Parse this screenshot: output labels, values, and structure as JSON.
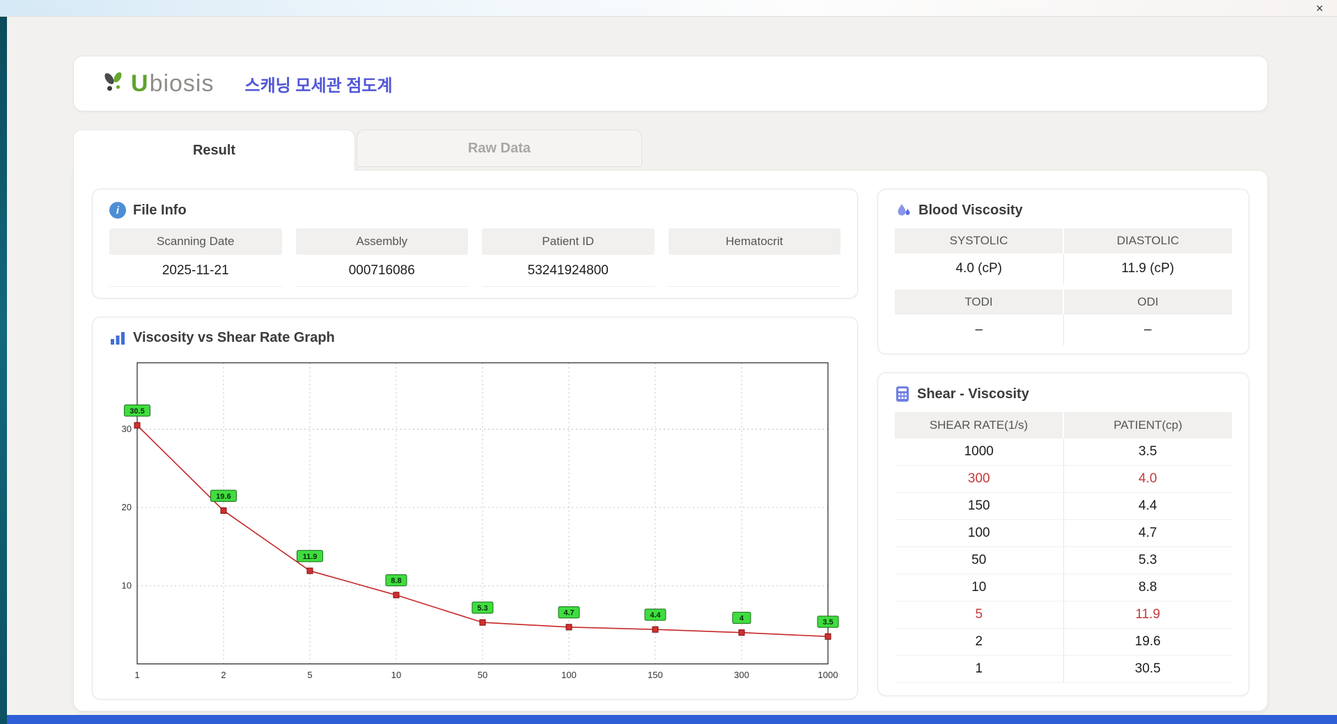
{
  "window": {
    "close_glyph": "×"
  },
  "header": {
    "logo_u": "U",
    "logo_rest": "biosis",
    "title_korean": "스캐닝 모세관 점도계"
  },
  "tabs": [
    {
      "label": "Result",
      "active": true
    },
    {
      "label": "Raw Data",
      "active": false
    }
  ],
  "file_info": {
    "title": "File Info",
    "fields": [
      {
        "label": "Scanning Date",
        "value": "2025-11-21"
      },
      {
        "label": "Assembly",
        "value": "000716086"
      },
      {
        "label": "Patient ID",
        "value": "53241924800"
      },
      {
        "label": "Hematocrit",
        "value": ""
      }
    ]
  },
  "blood_viscosity": {
    "title": "Blood Viscosity",
    "rows": [
      {
        "headers": [
          "SYSTOLIC",
          "DIASTOLIC"
        ],
        "values": [
          "4.0 (cP)",
          "11.9 (cP)"
        ]
      },
      {
        "headers": [
          "TODI",
          "ODI"
        ],
        "values": [
          "–",
          "–"
        ]
      }
    ]
  },
  "chart_data": {
    "type": "line",
    "title": "Viscosity vs Shear Rate Graph",
    "x": [
      1,
      2,
      5,
      10,
      50,
      100,
      150,
      300,
      1000
    ],
    "x_ticks": [
      "1",
      "2",
      "5",
      "10",
      "50",
      "100",
      "150",
      "300",
      "1000"
    ],
    "values": [
      30.5,
      19.6,
      11.9,
      8.8,
      5.3,
      4.7,
      4.4,
      4,
      3.5
    ],
    "labels": [
      "30.5",
      "19.6",
      "11.9",
      "8.8",
      "5.3",
      "4.7",
      "4.4",
      "4",
      "3.5"
    ],
    "xlabel": "",
    "ylabel": "",
    "x_scale": "categorical-evenly-spaced",
    "y_ticks": [
      10,
      20,
      30
    ],
    "ylim": [
      0,
      38.5
    ],
    "grid": true,
    "legend": "none",
    "line_color": "#c62828",
    "marker_color": "#d32f2f",
    "marker_border": "#7a1010",
    "label_bg": "#3fdd3f",
    "label_border": "#1a6b1a"
  },
  "shear_viscosity": {
    "title": "Shear - Viscosity",
    "columns": [
      "SHEAR RATE(1/s)",
      "PATIENT(cp)"
    ],
    "rows": [
      {
        "shear": "1000",
        "patient": "3.5",
        "highlight": false
      },
      {
        "shear": "300",
        "patient": "4.0",
        "highlight": true
      },
      {
        "shear": "150",
        "patient": "4.4",
        "highlight": false
      },
      {
        "shear": "100",
        "patient": "4.7",
        "highlight": false
      },
      {
        "shear": "50",
        "patient": "5.3",
        "highlight": false
      },
      {
        "shear": "10",
        "patient": "8.8",
        "highlight": false
      },
      {
        "shear": "5",
        "patient": "11.9",
        "highlight": true
      },
      {
        "shear": "2",
        "patient": "19.6",
        "highlight": false
      },
      {
        "shear": "1",
        "patient": "30.5",
        "highlight": false
      }
    ]
  }
}
